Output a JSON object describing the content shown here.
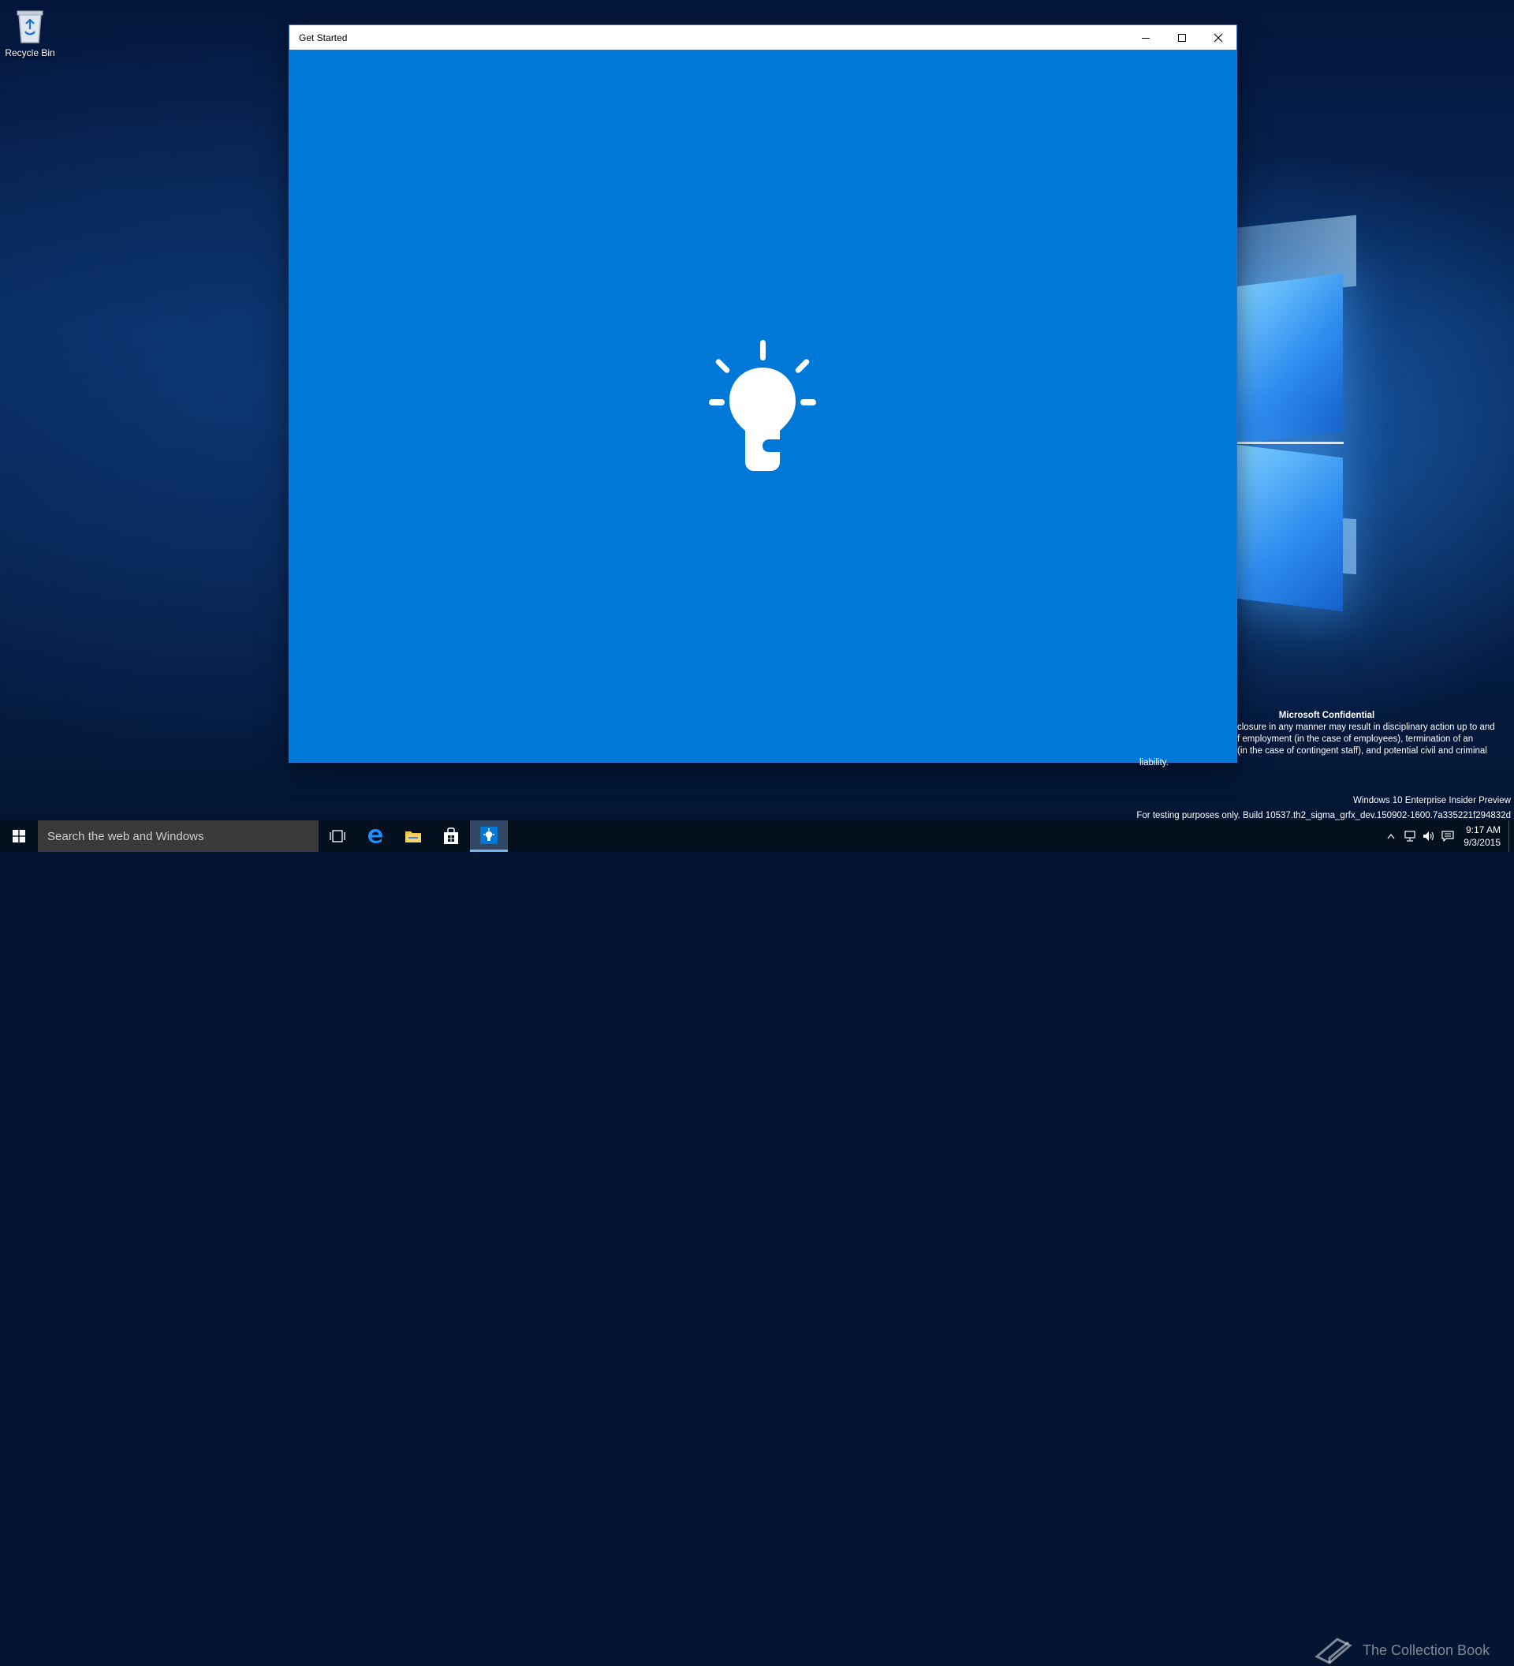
{
  "desktop": {
    "icons": [
      {
        "label": "Recycle Bin",
        "icon": "recycle-bin-icon"
      }
    ]
  },
  "window": {
    "title": "Get Started",
    "controls": {
      "minimize": "minimize-icon",
      "maximize": "maximize-icon",
      "close": "close-icon"
    },
    "splash_icon": "lightbulb-icon",
    "background_color": "#0078d7"
  },
  "confidential": {
    "title": "Microsoft Confidential",
    "lines": [
      "closure in any manner may result in disciplinary action up to and",
      "f employment (in the case of employees), termination of an",
      "(in the case of contingent staff), and potential civil and criminal",
      "liability."
    ]
  },
  "build_watermark": {
    "edition": "Windows 10 Enterprise Insider Preview",
    "build": "For testing purposes only. Build 10537.th2_sigma_grfx_dev.150902-1600.7a335221f294832d"
  },
  "taskbar": {
    "search_placeholder": "Search the web and Windows",
    "pinned": [
      {
        "name": "task-view",
        "icon": "task-view-icon"
      },
      {
        "name": "edge",
        "icon": "edge-icon"
      },
      {
        "name": "file-explorer",
        "icon": "folder-icon"
      },
      {
        "name": "store",
        "icon": "store-icon"
      },
      {
        "name": "get-started",
        "icon": "lightbulb-icon",
        "active": true
      }
    ],
    "clock": {
      "time": "9:17 AM",
      "date": "9/3/2015"
    }
  },
  "site_watermark": "The Collection Book"
}
